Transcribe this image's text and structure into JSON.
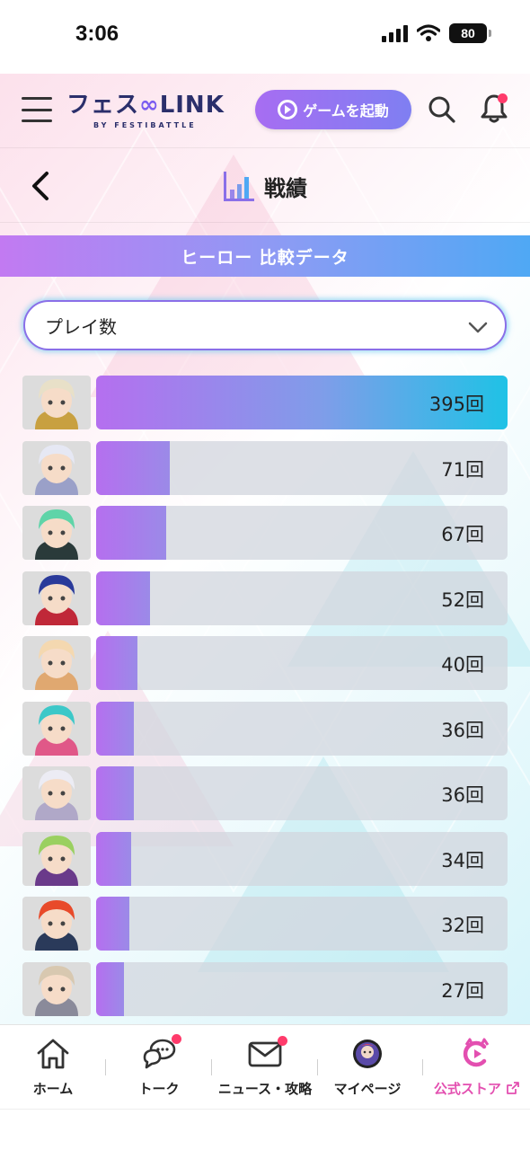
{
  "status_bar": {
    "time": "3:06",
    "battery": "80"
  },
  "header": {
    "logo_text": "フェス",
    "logo_text2": "LINK",
    "logo_sub": "BY FESTIBATTLE",
    "launch_button": "ゲームを起動"
  },
  "page": {
    "title": "戦績"
  },
  "section": {
    "title": "ヒーロー 比較データ"
  },
  "dropdown": {
    "selected": "プレイ数"
  },
  "ranking": {
    "max": 395,
    "items": [
      {
        "value": 395,
        "label": "395回",
        "colors": [
          "#e8e0c8",
          "#c8a040"
        ]
      },
      {
        "value": 71,
        "label": "71回",
        "colors": [
          "#e6e8f4",
          "#9aa0c8"
        ]
      },
      {
        "value": 67,
        "label": "67回",
        "colors": [
          "#5fd4a8",
          "#2a3a3a"
        ]
      },
      {
        "value": 52,
        "label": "52回",
        "colors": [
          "#2a3a9a",
          "#c02838"
        ]
      },
      {
        "value": 40,
        "label": "40回",
        "colors": [
          "#f4d8b0",
          "#e0a870"
        ]
      },
      {
        "value": 36,
        "label": "36回",
        "colors": [
          "#3cc8c8",
          "#e05888"
        ]
      },
      {
        "value": 36,
        "label": "36回",
        "colors": [
          "#ececf4",
          "#b0a8c8"
        ]
      },
      {
        "value": 34,
        "label": "34回",
        "colors": [
          "#9ad060",
          "#6a3a8a"
        ]
      },
      {
        "value": 32,
        "label": "32回",
        "colors": [
          "#e84a2a",
          "#2a3a5a"
        ]
      },
      {
        "value": 27,
        "label": "27回",
        "colors": [
          "#d8c8b0",
          "#8a8a9a"
        ]
      }
    ]
  },
  "bottom_nav": {
    "home": "ホーム",
    "talk": "トーク",
    "news": "ニュース・攻略",
    "mypage": "マイページ",
    "store": "公式ストア"
  },
  "colors": {
    "accent": "#8a6fe8",
    "bar_start": "#b56fef",
    "bar_end": "#1fc2e6",
    "badge": "#ff3b6b",
    "store": "#e34fb0"
  }
}
